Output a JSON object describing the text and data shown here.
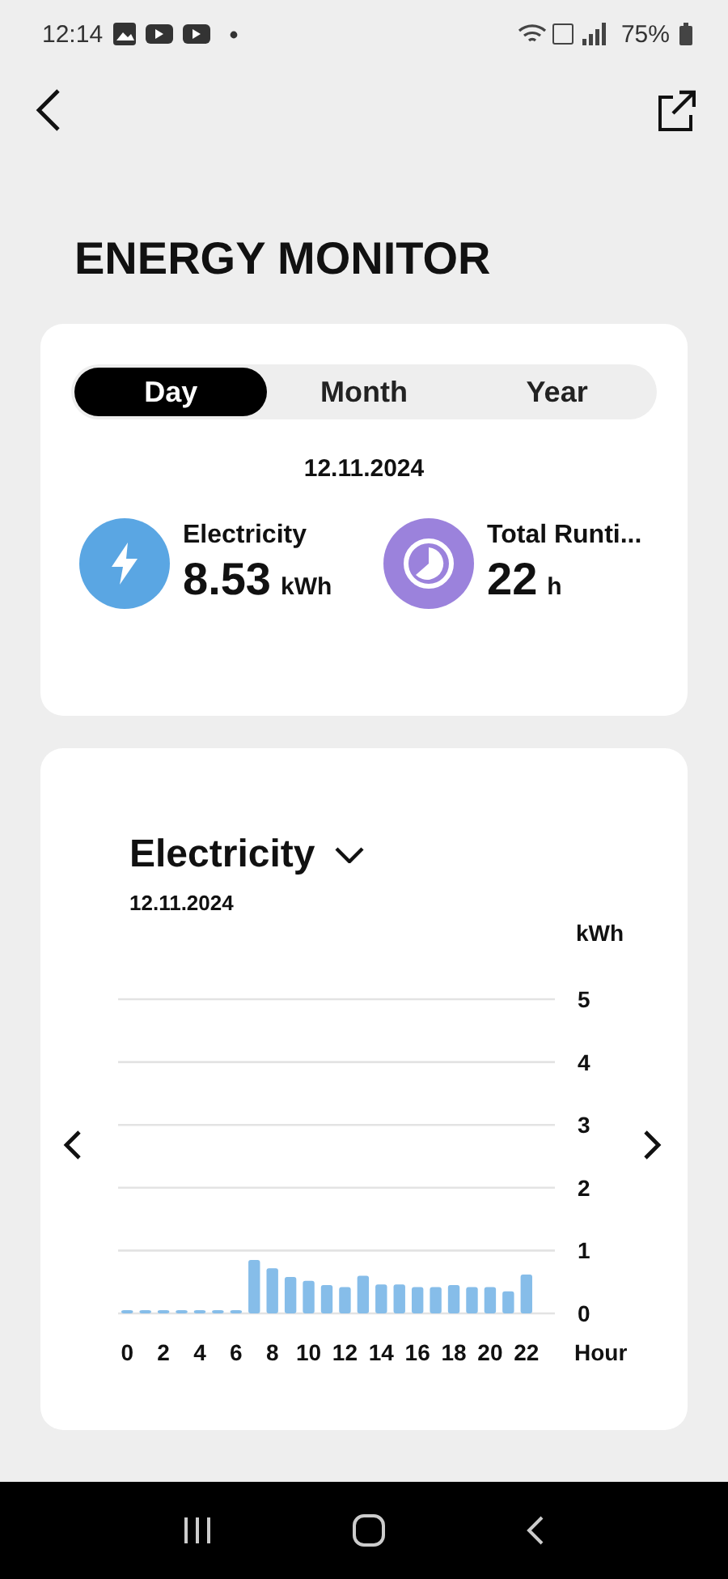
{
  "status_bar": {
    "time": "12:14",
    "battery": "75%"
  },
  "title": "ENERGY MONITOR",
  "period_tabs": [
    {
      "label": "Day",
      "selected": true
    },
    {
      "label": "Month",
      "selected": false
    },
    {
      "label": "Year",
      "selected": false
    }
  ],
  "date": "12.11.2024",
  "stats": [
    {
      "kind": "electricity",
      "label": "Electricity",
      "value": "8.53",
      "unit": "kWh",
      "color": "#5aa6e3"
    },
    {
      "kind": "runtime",
      "label": "Total Runti...",
      "value": "22",
      "unit": "h",
      "color": "#9b82dc"
    }
  ],
  "chart_card": {
    "metric": "Electricity",
    "date": "12.11.2024",
    "chart_data": {
      "type": "bar",
      "xlabel": "Hour",
      "ylabel": "kWh",
      "x": [
        0,
        1,
        2,
        3,
        4,
        5,
        6,
        7,
        8,
        9,
        10,
        11,
        12,
        13,
        14,
        15,
        16,
        17,
        18,
        19,
        20,
        21,
        22
      ],
      "series": [
        {
          "color": "#86bde9",
          "values": [
            0.05,
            0.05,
            0.05,
            0.05,
            0.05,
            0.05,
            0.05,
            0.85,
            0.72,
            0.58,
            0.52,
            0.45,
            0.42,
            0.6,
            0.46,
            0.46,
            0.42,
            0.42,
            0.45,
            0.42,
            0.42,
            0.35,
            0.62
          ]
        }
      ],
      "xlim": [
        -0.5,
        22.5
      ],
      "grid": true,
      "ylim": [
        0,
        5
      ],
      "yticks": [
        0,
        1,
        2,
        3,
        4,
        5
      ],
      "xticks": [
        0,
        2,
        4,
        6,
        8,
        10,
        12,
        14,
        16,
        18,
        20,
        22
      ]
    }
  }
}
